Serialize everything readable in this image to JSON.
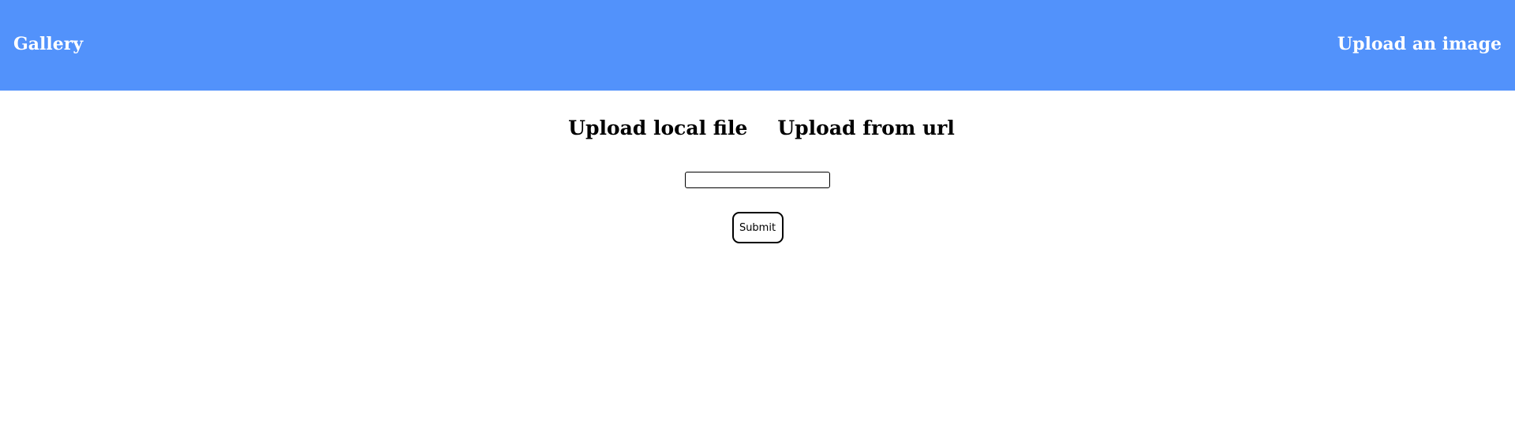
{
  "header": {
    "home_link": "Gallery",
    "upload_link": "Upload an image",
    "background_color": "#5292fb",
    "text_color": "#ffffff"
  },
  "upload": {
    "tabs": [
      {
        "label": "Upload local file"
      },
      {
        "label": "Upload from url"
      }
    ],
    "url_input": {
      "value": "",
      "placeholder": ""
    },
    "submit_label": "Submit"
  }
}
